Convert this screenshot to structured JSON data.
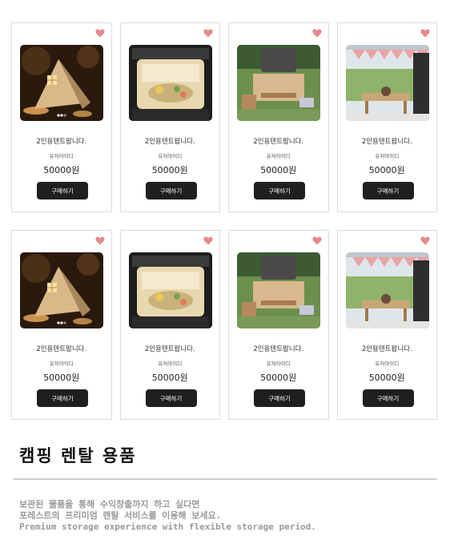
{
  "products": [
    {
      "image": "tent-icon",
      "title": "2인용텐트팝니다.",
      "user": "유저아이디",
      "price": "50000원",
      "button": "구매하기"
    },
    {
      "image": "car-trunk-icon",
      "title": "2인용텐트팝니다.",
      "user": "유저아이디",
      "price": "50000원",
      "button": "구매하기"
    },
    {
      "image": "picnic-table-icon",
      "title": "2인용텐트팝니다.",
      "user": "유저아이디",
      "price": "50000원",
      "button": "구매하기"
    },
    {
      "image": "car-picnic-icon",
      "title": "2인용텐트팝니다.",
      "user": "유저아이디",
      "price": "50000원",
      "button": "구매하기"
    },
    {
      "image": "tent-icon",
      "title": "2인용텐트팝니다.",
      "user": "유저아이디",
      "price": "50000원",
      "button": "구매하기"
    },
    {
      "image": "car-trunk-icon",
      "title": "2인용텐트팝니다.",
      "user": "유저아이디",
      "price": "50000원",
      "button": "구매하기"
    },
    {
      "image": "picnic-table-icon",
      "title": "2인용텐트팝니다.",
      "user": "유저아이디",
      "price": "50000원",
      "button": "구매하기"
    },
    {
      "image": "car-picnic-icon",
      "title": "2인용텐트팝니다.",
      "user": "유저아이디",
      "price": "50000원",
      "button": "구매하기"
    }
  ],
  "section": {
    "title": "캠핑 렌탈 용품",
    "lines": [
      "보관된 물품을 통해 수익창출까지 하고 싶다면",
      "포레스트의 프리미엄 렌탈 서비스를 이용해 보세요.",
      "Premium storage experience with flexible storage period."
    ]
  },
  "colors": {
    "heart": "#e58a8a",
    "button": "#1f1f1f",
    "border": "#dcdcdc",
    "desc": "#9a9a9a"
  }
}
